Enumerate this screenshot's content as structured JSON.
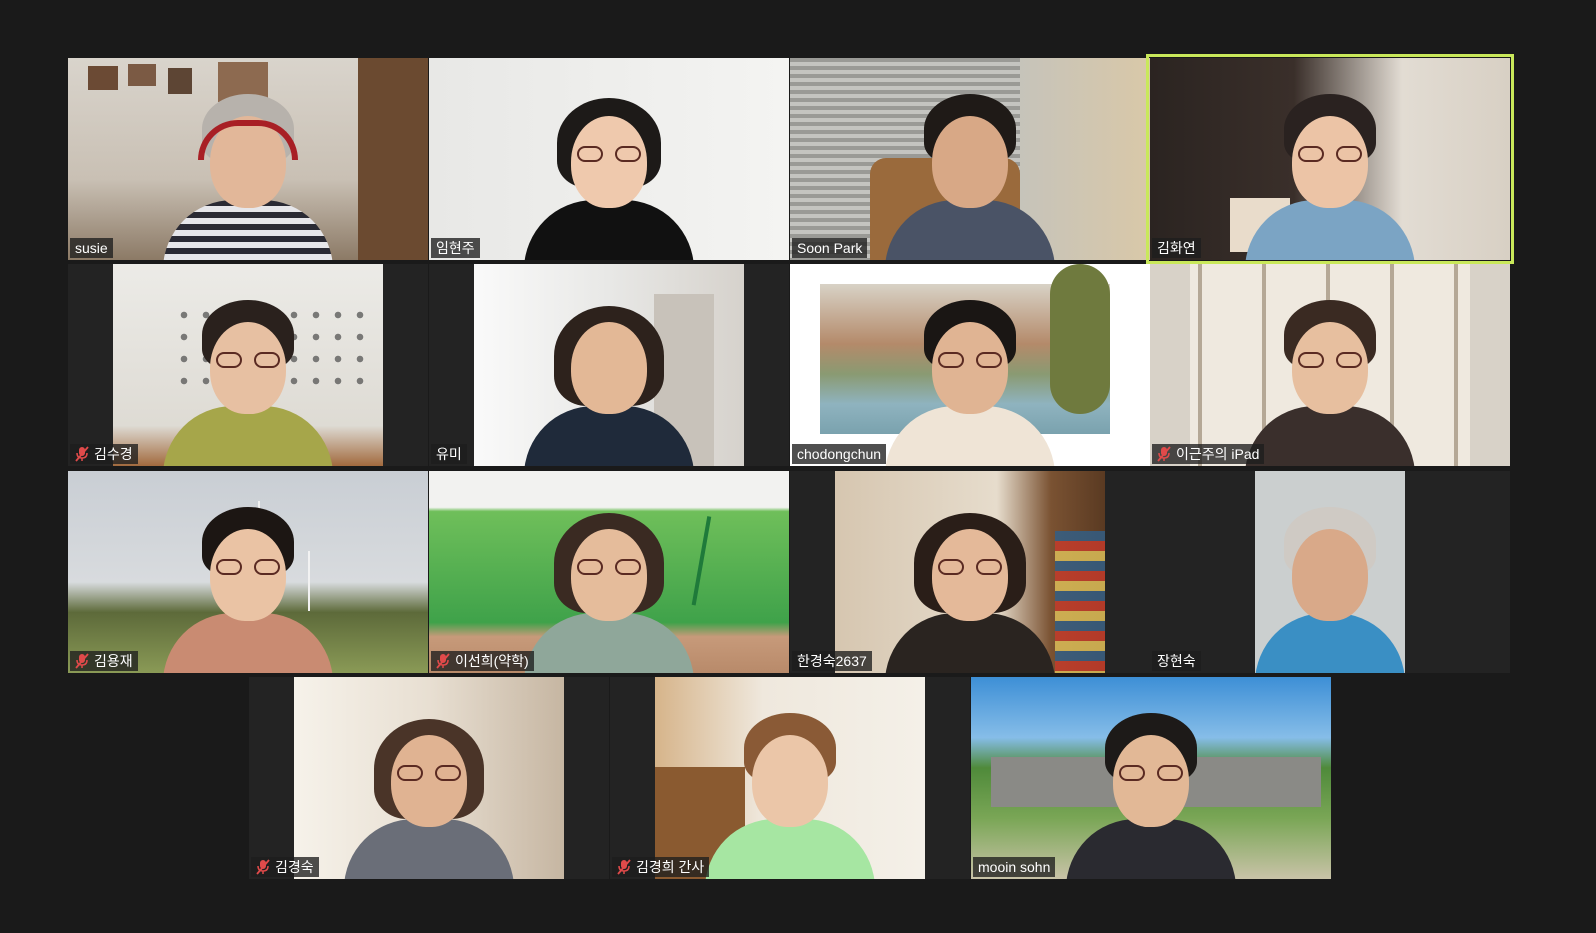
{
  "window": {
    "background": "#1a1a1a",
    "active_speaker_color": "#c9e85a"
  },
  "participants": [
    {
      "name": "susie",
      "muted": false,
      "active": false
    },
    {
      "name": "임현주",
      "muted": false,
      "active": false
    },
    {
      "name": "Soon Park",
      "muted": false,
      "active": false
    },
    {
      "name": "김화연",
      "muted": false,
      "active": true
    },
    {
      "name": "김수경",
      "muted": true,
      "active": false
    },
    {
      "name": "유미",
      "muted": false,
      "active": false
    },
    {
      "name": "chodongchun",
      "muted": false,
      "active": false
    },
    {
      "name": "이근주의 iPad",
      "muted": true,
      "active": false
    },
    {
      "name": "김용재",
      "muted": true,
      "active": false
    },
    {
      "name": "이선희(약학)",
      "muted": true,
      "active": false
    },
    {
      "name": "한경숙2637",
      "muted": false,
      "active": false
    },
    {
      "name": "장현숙",
      "muted": false,
      "active": false
    },
    {
      "name": "김경숙",
      "muted": true,
      "active": false
    },
    {
      "name": "김경희 간사",
      "muted": true,
      "active": false
    },
    {
      "name": "mooin sohn",
      "muted": false,
      "active": false
    }
  ],
  "icons": {
    "muted": "mic-muted-icon"
  }
}
